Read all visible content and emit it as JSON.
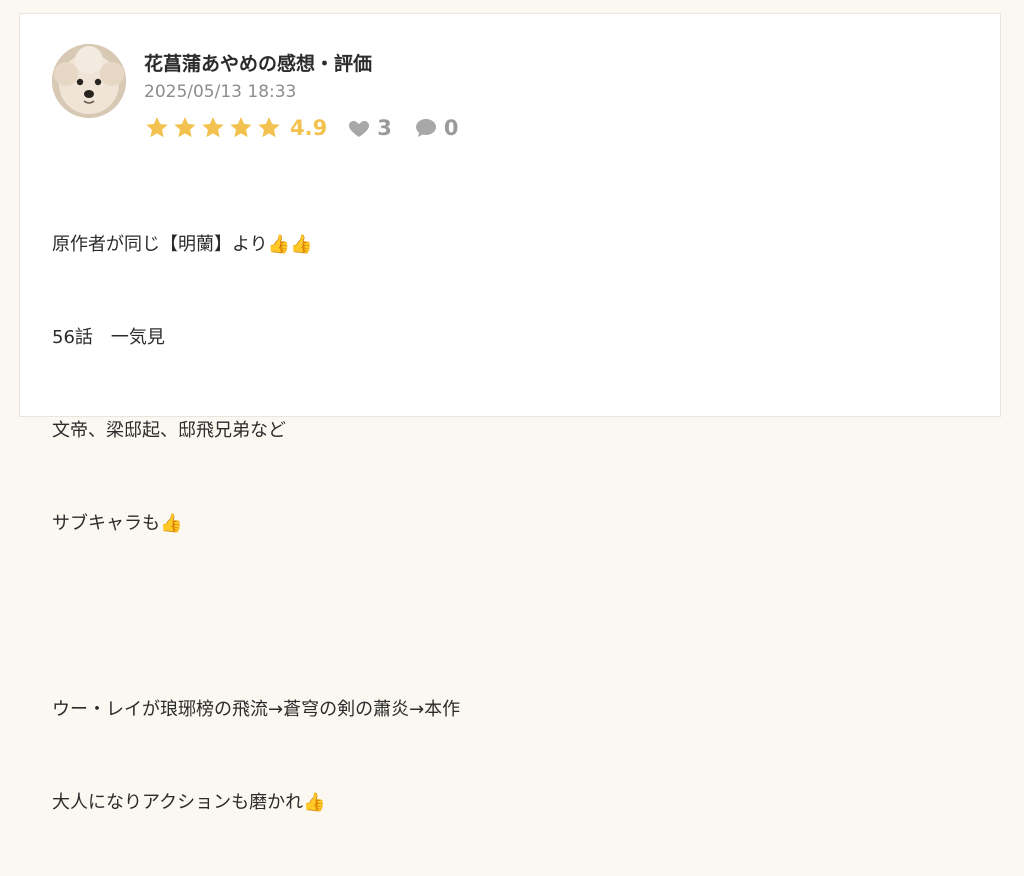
{
  "review": {
    "author": "花菖蒲あやめの感想・評価",
    "date": "2025/05/13 18:33",
    "rating": "4.9",
    "stars_filled": 5,
    "likes": "3",
    "comments": "0",
    "body_lines": [
      "原作者が同じ【明蘭】より👍👍",
      "56話　一気見",
      "文帝、梁邸起、邸飛兄弟など",
      "サブキャラも👍",
      "",
      "ウー・レイが琅琊榜の飛流→蒼穹の剣の蕭炎→本作",
      "大人になりアクションも磨かれ👍"
    ]
  },
  "icons": {
    "star": "star-icon",
    "like": "heart-icon",
    "comment": "comment-icon",
    "avatar": "dog-avatar"
  },
  "colors": {
    "background": "#fbf8f1",
    "card": "#ffffff",
    "star": "#f2c14e",
    "muted": "#9a9a9a",
    "text": "#2b2b2b"
  }
}
